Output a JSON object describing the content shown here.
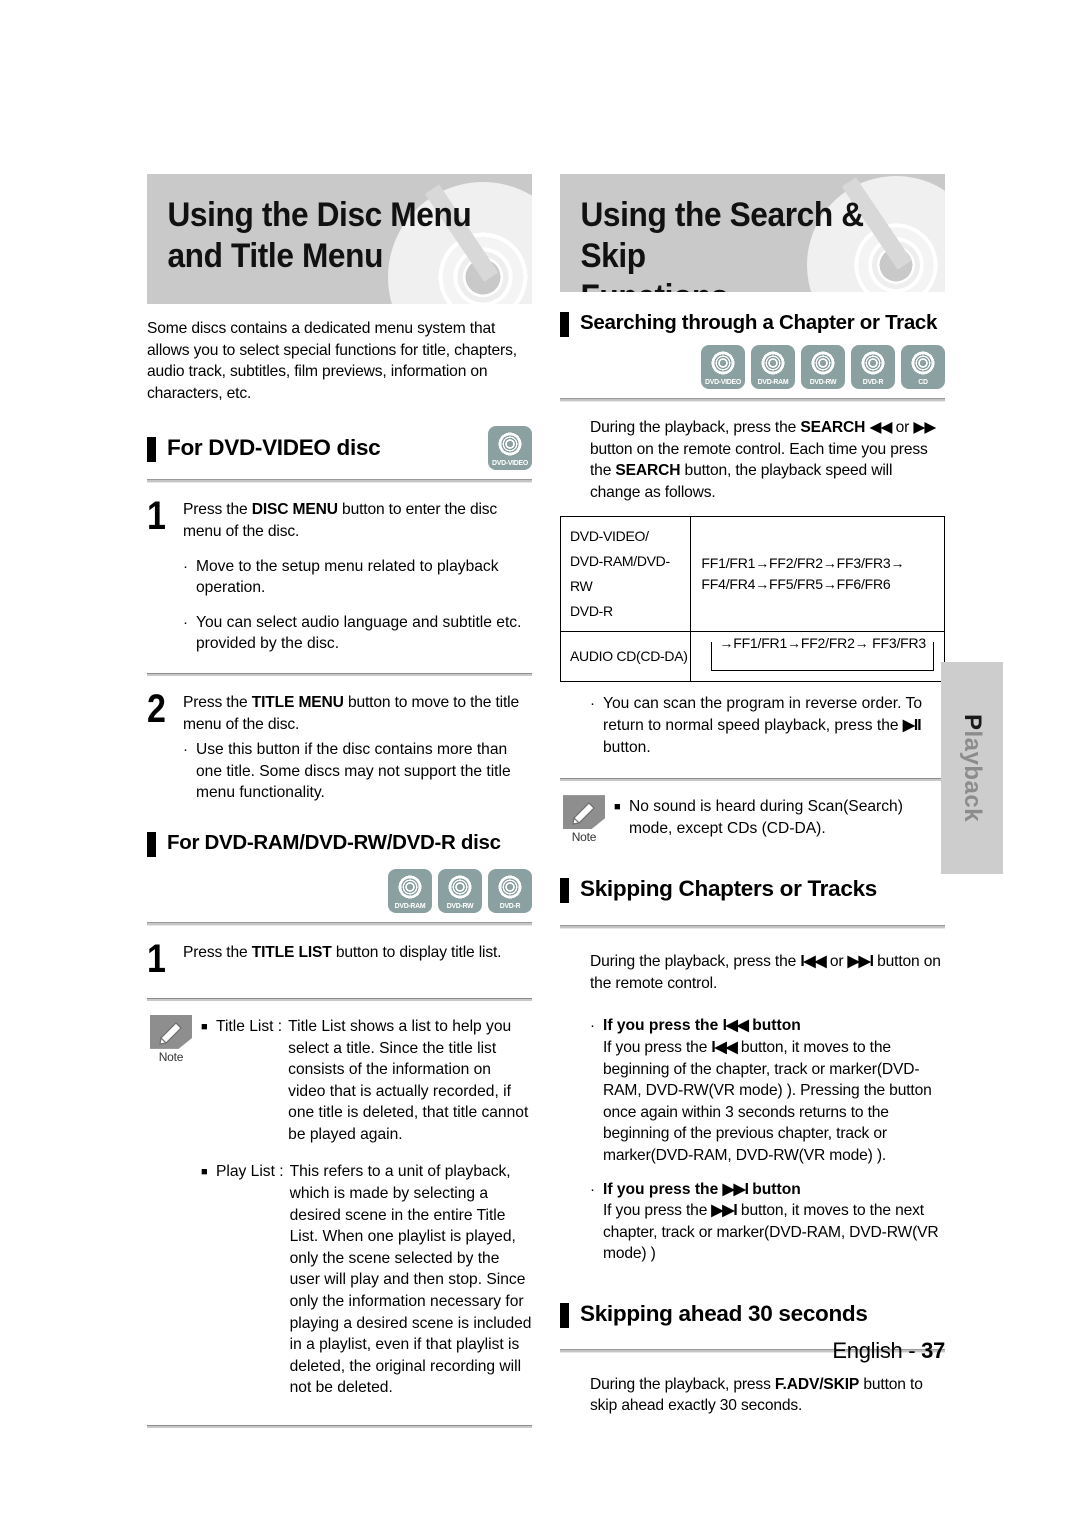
{
  "page": {
    "footer_language": "English - ",
    "footer_page": "37",
    "side_tab": "Playback",
    "side_tab_first": "P",
    "side_tab_rest": "layback"
  },
  "left_column": {
    "banner_title": "Using the Disc Menu\nand Title Menu",
    "intro": "Some discs contains a dedicated menu system that allows you to select special functions for title, chapters, audio track, subtitles, film previews, information on characters, etc.",
    "section_dvd_video": {
      "heading": "For DVD-VIDEO disc",
      "icons": [
        "DVD-VIDEO"
      ],
      "steps": [
        {
          "number": "1",
          "text_before": "Press the ",
          "bold": "DISC MENU",
          "text_after": " button to enter the disc menu of the disc.",
          "bullets": [
            "Move to the setup menu related to playback operation.",
            "You can select audio language and subtitle etc. provided by the disc."
          ]
        },
        {
          "number": "2",
          "text_before": "Press the ",
          "bold": "TITLE MENU",
          "text_after": " button to move to the title menu of the disc.",
          "bullets": [
            "Use this button if the disc contains more than one title. Some discs may not support the title menu functionality."
          ]
        }
      ]
    },
    "section_dvd_ram": {
      "heading": "For DVD-RAM/DVD-RW/DVD-R disc",
      "icons": [
        "DVD-RAM",
        "DVD-RW",
        "DVD-R"
      ],
      "steps": [
        {
          "number": "1",
          "text_before": "Press the ",
          "bold": "TITLE LIST",
          "text_after": " button to display title list."
        }
      ],
      "note": {
        "label": "Note",
        "items": [
          {
            "term": "Title List :",
            "definition": "Title List shows a list to help you select a title. Since the title list consists of the information on video that is actually recorded, if one title is deleted, that title cannot be played again."
          },
          {
            "term": "Play List :",
            "definition": "This refers to a unit of playback, which is made by selecting a desired scene in the entire Title List. When one playlist is played, only the scene selected by the user will play and then stop. Since only the information necessary for playing a desired scene is included in a playlist, even if that playlist is deleted, the original recording will not be deleted."
          }
        ]
      }
    }
  },
  "right_column": {
    "banner_title": "Using the Search & Skip\nFunctions",
    "section_search": {
      "heading": "Searching through a Chapter or Track",
      "icons": [
        "DVD-VIDEO",
        "DVD-RAM",
        "DVD-RW",
        "DVD-R",
        "CD"
      ],
      "paragraph_part1": "During the playback, press the ",
      "paragraph_bold1": "SEARCH",
      "paragraph_rev_icon": "◀◀",
      "paragraph_or": " or ",
      "paragraph_fwd_icon": "▶▶",
      "paragraph_part2": " button on the remote control. Each time you press the ",
      "paragraph_bold2": "SEARCH",
      "paragraph_part3": " button, the playback speed will change as follows.",
      "table": {
        "rows": [
          {
            "label": "DVD-VIDEO/\nDVD-RAM/DVD-RW\nDVD-R",
            "value_line1": "FF1/FR1→FF2/FR2→FF3/FR3→",
            "value_line2": "FF4/FR4→FF5/FR5→FF6/FR6",
            "looped": false
          },
          {
            "label": "AUDIO CD(CD-DA)",
            "value_line1": "→FF1/FR1→FF2/FR2→ FF3/FR3",
            "value_line2": "",
            "looped": true
          }
        ]
      },
      "bullet": "You can scan the program in reverse order. To return to normal speed playback, press the",
      "bullet_icon": "▶II",
      "bullet_tail": " button.",
      "note": {
        "label": "Note",
        "items": [
          {
            "term": "",
            "definition": "No sound is heard during Scan(Search) mode, except CDs (CD-DA)."
          }
        ]
      }
    },
    "section_skipping": {
      "heading": "Skipping Chapters or Tracks",
      "paragraph_part1": "During the playback, press the ",
      "paragraph_prev_icon": "I◀◀",
      "paragraph_or": " or ",
      "paragraph_next_icon": "▶▶I",
      "paragraph_part2": " button on the remote control.",
      "sub_sections": [
        {
          "title_before": "If you press the ",
          "title_icon": "I◀◀",
          "title_after": " button",
          "body_before": "If you press the ",
          "body_icon": "I◀◀",
          "body_after": " button, it moves to the beginning of the chapter, track or marker(DVD-RAM, DVD-RW(VR mode) ). Pressing the button once again within 3 seconds returns to the beginning of the previous chapter, track or marker(DVD-RAM, DVD-RW(VR mode) )."
        },
        {
          "title_before": "If you press the ",
          "title_icon": "▶▶I",
          "title_after": " button",
          "body_before": "If you press the ",
          "body_icon": "▶▶I",
          "body_after": " button, it moves to the next chapter, track or marker(DVD-RAM, DVD-RW(VR mode) )"
        }
      ]
    },
    "section_skip30": {
      "heading": "Skipping ahead 30 seconds",
      "paragraph_part1": "During the playback, press ",
      "paragraph_bold": "F.ADV/SKIP",
      "paragraph_part2": " button to skip ahead exactly 30 seconds."
    }
  },
  "colors": {
    "banner_bg": "#c9c9c9",
    "disc_icon_bg": "#8ba0a0",
    "note_icon_bg": "#8e8e8e",
    "side_tab_bg": "#cdcdcd"
  }
}
